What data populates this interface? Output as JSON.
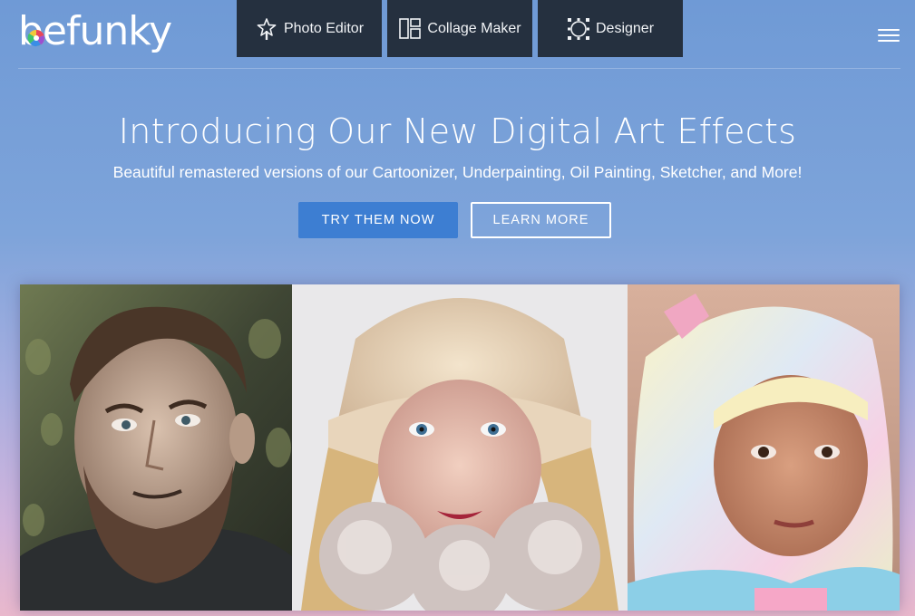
{
  "header": {
    "logo_text": "befunky",
    "nav": [
      {
        "label": "Photo Editor",
        "icon": "star-wand-icon"
      },
      {
        "label": "Collage Maker",
        "icon": "collage-grid-icon"
      },
      {
        "label": "Designer",
        "icon": "designer-circle-icon"
      }
    ],
    "menu_icon": "hamburger-menu-icon"
  },
  "hero": {
    "title": "Introducing Our New Digital Art Effects",
    "subtitle": "Beautiful remastered versions of our Cartoonizer, Underpainting, Oil Painting, Sketcher, and More!",
    "primary_button": "TRY THEM NOW",
    "secondary_button": "LEARN MORE"
  },
  "gallery": {
    "images": [
      {
        "subject": "bearded-man-portrait"
      },
      {
        "subject": "woman-in-fur-hat-portrait"
      },
      {
        "subject": "girl-with-pastel-hair-portrait"
      }
    ]
  },
  "colors": {
    "nav_tab_bg": "#25303f",
    "primary_button": "#3d7ed2",
    "background_top": "#6f9ad6",
    "background_bottom": "#e9b8cc"
  }
}
